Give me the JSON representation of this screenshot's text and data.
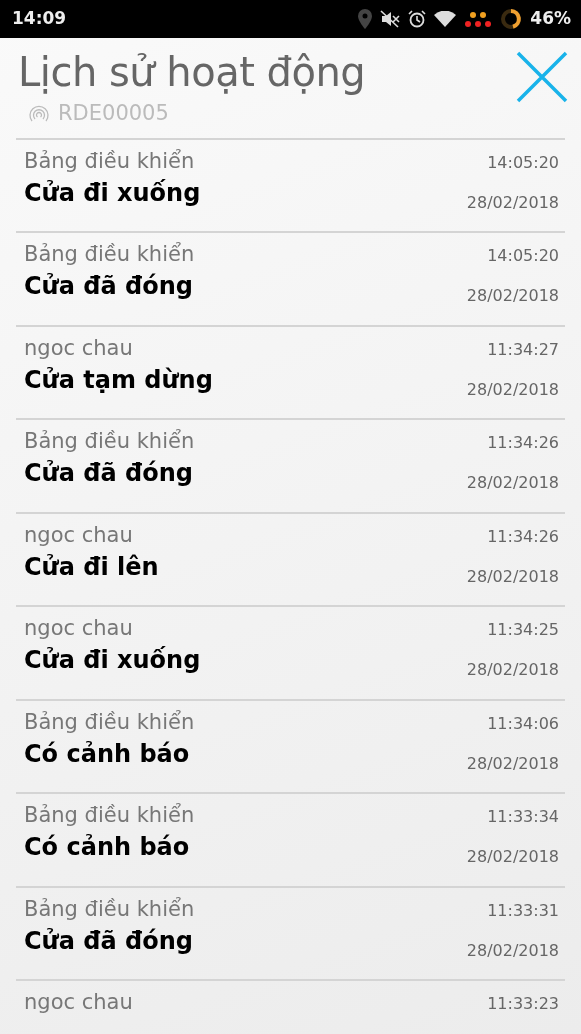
{
  "status_bar": {
    "time": "14:09",
    "battery": "46%"
  },
  "header": {
    "title": "Lịch sử hoạt động",
    "device": "RDE00005"
  },
  "events": [
    {
      "source": "Bảng điều khiển",
      "action": "Cửa đi xuống",
      "time": "14:05:20",
      "date": "28/02/2018"
    },
    {
      "source": "Bảng điều khiển",
      "action": "Cửa đã đóng",
      "time": "14:05:20",
      "date": "28/02/2018"
    },
    {
      "source": "ngoc chau",
      "action": "Cửa tạm dừng",
      "time": "11:34:27",
      "date": "28/02/2018"
    },
    {
      "source": "Bảng điều khiển",
      "action": "Cửa đã đóng",
      "time": "11:34:26",
      "date": "28/02/2018"
    },
    {
      "source": "ngoc chau",
      "action": "Cửa đi lên",
      "time": "11:34:26",
      "date": "28/02/2018"
    },
    {
      "source": "ngoc chau",
      "action": "Cửa đi xuống",
      "time": "11:34:25",
      "date": "28/02/2018"
    },
    {
      "source": "Bảng điều khiển",
      "action": "Có cảnh báo",
      "time": "11:34:06",
      "date": "28/02/2018"
    },
    {
      "source": "Bảng điều khiển",
      "action": "Có cảnh báo",
      "time": "11:33:34",
      "date": "28/02/2018"
    },
    {
      "source": "Bảng điều khiển",
      "action": "Cửa đã đóng",
      "time": "11:33:31",
      "date": "28/02/2018"
    },
    {
      "source": "ngoc chau",
      "time": "11:33:23"
    }
  ]
}
